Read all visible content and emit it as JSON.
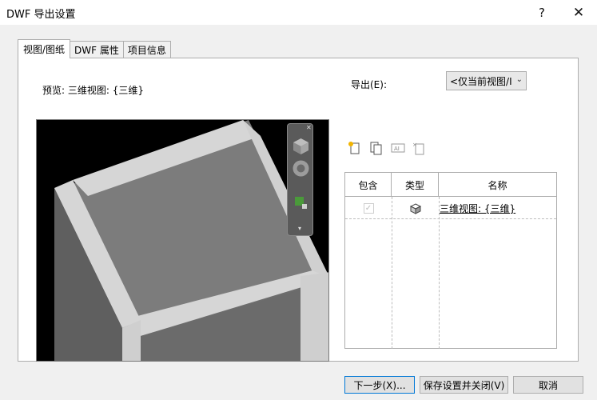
{
  "window": {
    "title": "DWF 导出设置",
    "help_glyph": "?",
    "close_glyph": "✕"
  },
  "tabs": [
    {
      "label": "视图/图纸",
      "active": true
    },
    {
      "label": "DWF 属性",
      "active": false
    },
    {
      "label": "项目信息",
      "active": false
    }
  ],
  "preview": {
    "label": "预览: 三维视图: {三维}"
  },
  "export": {
    "label": "导出(E):",
    "selected": "<仅当前视图/I"
  },
  "table": {
    "headers": [
      "包含",
      "类型",
      "名称"
    ],
    "rows": [
      {
        "include": true,
        "type_icon": "3d-view-icon",
        "name": "三维视图: {三维}"
      }
    ]
  },
  "buttons": {
    "next": "下一步(X)...",
    "save_close": "保存设置并关闭(V)",
    "cancel": "取消"
  }
}
